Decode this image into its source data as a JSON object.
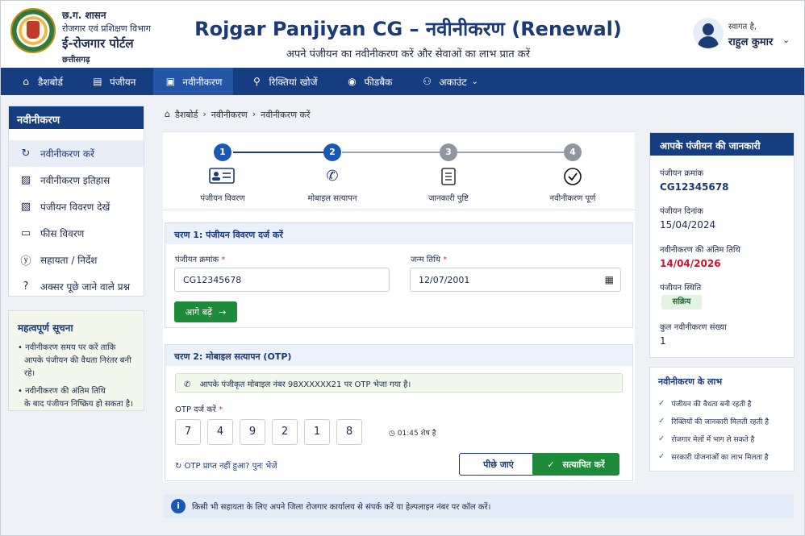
{
  "header": {
    "gov_line1": "छ.ग. शासन",
    "gov_line2": "रोजगार एवं प्रशिक्षण विभाग",
    "portal_name": "ई-रोजगार पोर्टल",
    "state": "छत्तीसगढ़",
    "title": "Rojgar Panjiyan CG – नवीनीकरण (Renewal)",
    "subtitle": "अपने पंजीयन का नवीनीकरण करें और सेवाओं का लाभ प्रात करें",
    "welcome": "स्वागत है,",
    "user_name": "राहुल कुमार"
  },
  "nav": [
    {
      "label": "डैशबोर्ड",
      "icon": "home-icon"
    },
    {
      "label": "पंजीयन",
      "icon": "form-icon"
    },
    {
      "label": "नवीनीकरण",
      "icon": "calendar-icon"
    },
    {
      "label": "रिक्तियां खोजें",
      "icon": "search-icon"
    },
    {
      "label": "फीडबैक",
      "icon": "feedback-icon"
    },
    {
      "label": "अकाउंट",
      "icon": "users-icon"
    }
  ],
  "sidebar": {
    "title": "नवीनीकरण",
    "items": [
      {
        "label": "नवीनीकरण करें",
        "icon": "refresh-icon"
      },
      {
        "label": "नवीनीकरण इतिहास",
        "icon": "history-icon"
      },
      {
        "label": "पंजीयन विवरण देखें",
        "icon": "document-icon"
      },
      {
        "label": "फीस विवरण",
        "icon": "fee-icon"
      },
      {
        "label": "सहायता / निर्देश",
        "icon": "help-icon"
      },
      {
        "label": "अक्सर पूछे जाने वाले प्रश्न",
        "icon": "question-icon"
      }
    ]
  },
  "notice": {
    "title": "महत्वपूर्ण सूचना",
    "items": [
      [
        "• नवीनीकरण समय पर करें ताकि",
        "आपके पंजीयन की वैधता निरंतर बनी रहे।"
      ],
      [
        "• नवीनीकरण की अंतिम तिथि",
        "के बाद पंजीयन निष्क्रिय हो सकता है।"
      ]
    ]
  },
  "breadcrumb": [
    "डैशबोर्ड",
    "नवीनीकरण",
    "नवीनीकरण करें"
  ],
  "steps": [
    {
      "num": "1",
      "label": "पंजीयन विवरण",
      "state": "done"
    },
    {
      "num": "2",
      "label": "मोबाइल सत्यापन",
      "state": "active"
    },
    {
      "num": "3",
      "label": "जानकारी पुष्टि",
      "state": "pending"
    },
    {
      "num": "4",
      "label": "नवीनीकरण पूर्ण",
      "state": "pending"
    }
  ],
  "step1": {
    "title": "चरण 1: पंजीयन विवरण दर्ज करें",
    "reg_label": "पंजीयन क्रमांक",
    "reg_value": "CG12345678",
    "dob_label": "जन्म तिथि",
    "dob_value": "12/07/2001",
    "next_button": "आगे बढ़ें"
  },
  "step2": {
    "title": "चरण 2: मोबाइल सत्यापन (OTP)",
    "info": "आपके पंजीकृत मोबाइल नंबर 98XXXXXX21 पर OTP भेजा गया है।",
    "otp_label": "OTP दर्ज करें",
    "otp_digits": [
      "7",
      "4",
      "9",
      "2",
      "1",
      "8"
    ],
    "timer": "01:45 शेष है",
    "resend": "OTP प्राप्त नहीं हुआ? पुनः भेजें",
    "back_button": "पीछे जाएं",
    "verify_button": "सत्यापित करें"
  },
  "help": "किसी भी सहायता के लिए अपने जिला रोजगार कार्यालय से संपर्क करें या हेल्पलाइन नंबर पर कॉल करें।",
  "info_panel": {
    "title": "आपके पंजीयन की जानकारी",
    "reg_no_label": "पंजीयन क्रमांक",
    "reg_no": "CG12345678",
    "reg_date_label": "पंजीयन दिनांक",
    "reg_date": "15/04/2024",
    "last_date_label": "नवीनीकरण की अंतिम तिथि",
    "last_date": "14/04/2026",
    "status_label": "पंजीयन स्थिति",
    "status": "सक्रिय",
    "count_label": "कुल नवीनीकरण संख्या",
    "count": "1"
  },
  "benefits": {
    "title": "नवीनीकरण के लाभ",
    "items": [
      "पंजीयन की वैधता बनी रहती है",
      "रिक्तियों की जानकारी मिलती रहती है",
      "रोजगार मेलों में भाग ले सकते है",
      "सरकारी योजनाओं का लाभ मिलता है"
    ]
  },
  "colors": {
    "primary": "#163d80",
    "accent_green": "#1e8b3a",
    "deadline_red": "#d0112b"
  }
}
